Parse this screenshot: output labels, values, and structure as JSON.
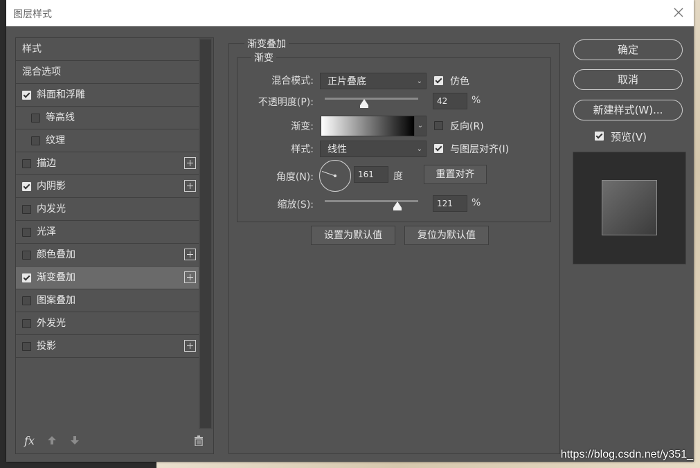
{
  "dialog": {
    "title": "图层样式"
  },
  "styles": {
    "items": [
      {
        "label": "样式",
        "checkbox": false,
        "plus": false,
        "indent": false
      },
      {
        "label": "混合选项",
        "checkbox": false,
        "plus": false,
        "indent": false
      },
      {
        "label": "斜面和浮雕",
        "checkbox": true,
        "checked": true,
        "plus": false,
        "indent": false
      },
      {
        "label": "等高线",
        "checkbox": true,
        "checked": false,
        "plus": false,
        "indent": true
      },
      {
        "label": "纹理",
        "checkbox": true,
        "checked": false,
        "plus": false,
        "indent": true
      },
      {
        "label": "描边",
        "checkbox": true,
        "checked": false,
        "plus": true,
        "indent": false
      },
      {
        "label": "内阴影",
        "checkbox": true,
        "checked": true,
        "plus": true,
        "indent": false
      },
      {
        "label": "内发光",
        "checkbox": true,
        "checked": false,
        "plus": false,
        "indent": false
      },
      {
        "label": "光泽",
        "checkbox": true,
        "checked": false,
        "plus": false,
        "indent": false
      },
      {
        "label": "颜色叠加",
        "checkbox": true,
        "checked": false,
        "plus": true,
        "indent": false
      },
      {
        "label": "渐变叠加",
        "checkbox": true,
        "checked": true,
        "plus": true,
        "indent": false,
        "selected": true
      },
      {
        "label": "图案叠加",
        "checkbox": true,
        "checked": false,
        "plus": false,
        "indent": false
      },
      {
        "label": "外发光",
        "checkbox": true,
        "checked": false,
        "plus": false,
        "indent": false
      },
      {
        "label": "投影",
        "checkbox": true,
        "checked": false,
        "plus": true,
        "indent": false
      }
    ],
    "fx_label": "fx"
  },
  "gradient_overlay": {
    "section_title": "渐变叠加",
    "group_title": "渐变",
    "blend_mode": {
      "label": "混合模式:",
      "value": "正片叠底"
    },
    "dither": {
      "label": "仿色",
      "checked": true
    },
    "opacity": {
      "label": "不透明度(P):",
      "value": "42",
      "unit": "%",
      "fraction": 0.42
    },
    "gradient": {
      "label": "渐变:",
      "from_color": "#ffffff",
      "to_color": "#000000"
    },
    "reverse": {
      "label": "反向(R)",
      "checked": false
    },
    "style": {
      "label": "样式:",
      "value": "线性"
    },
    "align": {
      "label": "与图层对齐(I)",
      "checked": true
    },
    "angle": {
      "label": "角度(N):",
      "value": "161",
      "unit": "度",
      "degrees": 161
    },
    "reset_align_button": "重置对齐",
    "scale": {
      "label": "缩放(S):",
      "value": "121",
      "unit": "%",
      "fraction": 0.78
    },
    "set_default_button": "设置为默认值",
    "reset_default_button": "复位为默认值"
  },
  "actions": {
    "ok": "确定",
    "cancel": "取消",
    "new_style": "新建样式(W)...",
    "preview": {
      "label": "预览(V)",
      "checked": true
    }
  },
  "watermark": "https://blog.csdn.net/y351_",
  "colors": {
    "dialog_bg": "#535353",
    "selected_row": "#6a6a6a",
    "titlebar": "#ffffff"
  }
}
